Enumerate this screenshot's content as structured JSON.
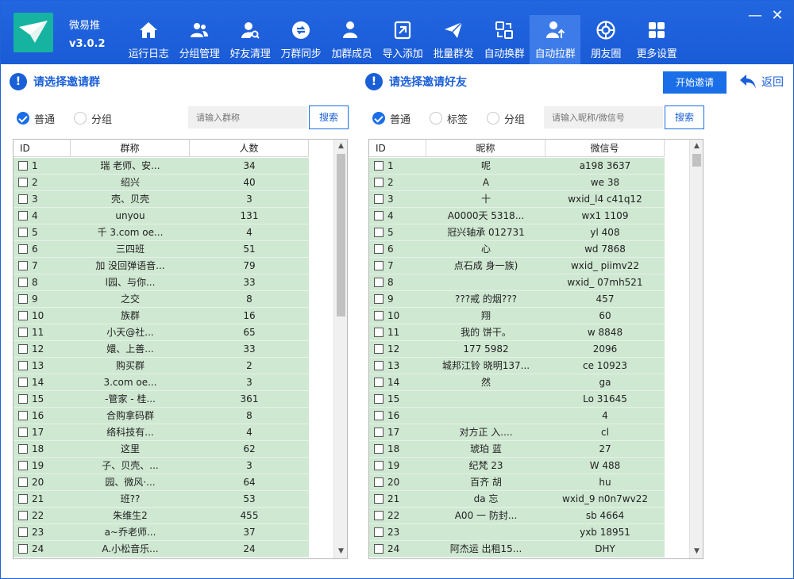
{
  "app": {
    "name": "微易推",
    "version": "v3.0.2"
  },
  "nav": [
    {
      "label": "运行日志",
      "icon": "home-icon"
    },
    {
      "label": "分组管理",
      "icon": "users-icon"
    },
    {
      "label": "好友清理",
      "icon": "user-search-icon"
    },
    {
      "label": "万群同步",
      "icon": "sync-icon"
    },
    {
      "label": "加群成员",
      "icon": "add-member-icon"
    },
    {
      "label": "导入添加",
      "icon": "import-icon"
    },
    {
      "label": "批量群发",
      "icon": "send-icon"
    },
    {
      "label": "自动换群",
      "icon": "switch-group-icon"
    },
    {
      "label": "自动拉群",
      "icon": "pull-group-icon",
      "active": true
    },
    {
      "label": "朋友圈",
      "icon": "moments-icon"
    },
    {
      "label": "更多设置",
      "icon": "grid-icon"
    }
  ],
  "window": {
    "minimize": "—",
    "close": "✕"
  },
  "left": {
    "title": "请选择邀请群",
    "radios": [
      {
        "label": "普通",
        "checked": true
      },
      {
        "label": "分组",
        "checked": false
      }
    ],
    "search_placeholder": "请输入群称",
    "search_button": "搜索",
    "columns": [
      "ID",
      "群称",
      "人数"
    ],
    "rows": [
      [
        "1",
        "瑞  老师、安...",
        "34"
      ],
      [
        "2",
        "绍兴",
        "40"
      ],
      [
        "3",
        "壳、贝壳",
        "3"
      ],
      [
        "4",
        "unyou",
        "131"
      ],
      [
        "5",
        "千  3.com oe...",
        "4"
      ],
      [
        "6",
        "三四班",
        "51"
      ],
      [
        "7",
        "加  没回弹语音...",
        "79"
      ],
      [
        "8",
        "l园、与你...",
        "33"
      ],
      [
        "9",
        "之交",
        "8"
      ],
      [
        "10",
        "族群",
        "16"
      ],
      [
        "11",
        "小天@社...",
        "65"
      ],
      [
        "12",
        "嬛、上善...",
        "33"
      ],
      [
        "13",
        "购买群",
        "2"
      ],
      [
        "14",
        "3.com oe...",
        "3"
      ],
      [
        "15",
        "-管家 - 桂...",
        "361"
      ],
      [
        "16",
        "合购拿码群",
        "8"
      ],
      [
        "17",
        "络科技有...",
        "4"
      ],
      [
        "18",
        "这里",
        "62"
      ],
      [
        "19",
        "子、贝壳、...",
        "3"
      ],
      [
        "20",
        "园、微风·...",
        "64"
      ],
      [
        "21",
        "班??",
        "53"
      ],
      [
        "22",
        "朱维生2",
        "455"
      ],
      [
        "23",
        "a~乔老师...",
        "37"
      ],
      [
        "24",
        "A.小松音乐...",
        "24"
      ]
    ]
  },
  "right": {
    "title": "请选择邀请好友",
    "start_button": "开始邀请",
    "back_button": "返回",
    "radios": [
      {
        "label": "普通",
        "checked": true
      },
      {
        "label": "标签",
        "checked": false
      },
      {
        "label": "分组",
        "checked": false
      }
    ],
    "search_placeholder": "请输入昵称/微信号",
    "search_button": "搜索",
    "columns": [
      "ID",
      "昵称",
      "微信号"
    ],
    "rows": [
      [
        "1",
        "呢",
        "a198  3637"
      ],
      [
        "2",
        "A",
        "we  38"
      ],
      [
        "3",
        "十",
        "wxid_l4  c41q12"
      ],
      [
        "4",
        "A0000天  5318...",
        "wx1  1109"
      ],
      [
        "5",
        "冠兴轴承  012731",
        "yl  408"
      ],
      [
        "6",
        "心",
        "wd  7868"
      ],
      [
        "7",
        "点石成  身一族)",
        "wxid_  piimv22"
      ],
      [
        "8",
        "",
        "wxid_  07mh521"
      ],
      [
        "9",
        "???戒  的烟???",
        "457"
      ],
      [
        "10",
        "翔",
        "60"
      ],
      [
        "11",
        "我的  饼干。",
        "w  8848"
      ],
      [
        "12",
        "177  5982",
        "2096"
      ],
      [
        "13",
        "城邦江铃  晓明137...",
        "ce  10923"
      ],
      [
        "14",
        "然",
        "ga"
      ],
      [
        "15",
        "",
        "Lo  31645"
      ],
      [
        "16",
        "",
        "4"
      ],
      [
        "17",
        "对方正  入....",
        "cl"
      ],
      [
        "18",
        "琥珀  蓝",
        "27"
      ],
      [
        "19",
        "纪梵  23",
        "W  488"
      ],
      [
        "20",
        "百齐  胡",
        "hu"
      ],
      [
        "21",
        "da  忘",
        "wxid_9  n0n7wv22"
      ],
      [
        "22",
        "A00  一  防封...",
        "sb  4664"
      ],
      [
        "23",
        "",
        "yxb  18951"
      ],
      [
        "24",
        "阿杰运  出租15...",
        "DHY"
      ]
    ]
  }
}
